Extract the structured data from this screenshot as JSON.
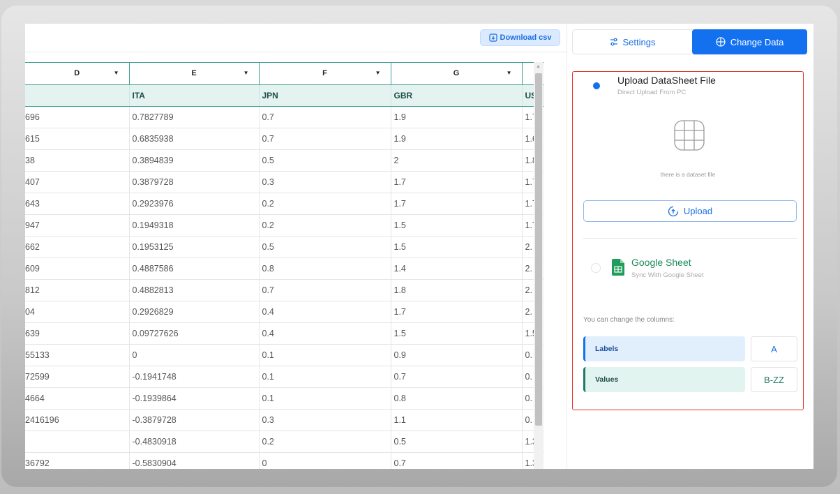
{
  "toolbar": {
    "download_label": "Download csv"
  },
  "table": {
    "column_letters": [
      "D",
      "E",
      "F",
      "G",
      ""
    ],
    "column_names": [
      "",
      "ITA",
      "JPN",
      "GBR",
      "US"
    ],
    "rows": [
      [
        "696",
        "0.7827789",
        "0.7",
        "1.9",
        "1.7"
      ],
      [
        "615",
        "0.6835938",
        "0.7",
        "1.9",
        "1.6"
      ],
      [
        "38",
        "0.3894839",
        "0.5",
        "2",
        "1.8"
      ],
      [
        "407",
        "0.3879728",
        "0.3",
        "1.7",
        "1.7"
      ],
      [
        "643",
        "0.2923976",
        "0.2",
        "1.7",
        "1.7"
      ],
      [
        "947",
        "0.1949318",
        "0.2",
        "1.5",
        "1.7"
      ],
      [
        "662",
        "0.1953125",
        "0.5",
        "1.5",
        "2."
      ],
      [
        "609",
        "0.4887586",
        "0.8",
        "1.4",
        "2."
      ],
      [
        "812",
        "0.4882813",
        "0.7",
        "1.8",
        "2."
      ],
      [
        "04",
        "0.2926829",
        "0.4",
        "1.7",
        "2."
      ],
      [
        "639",
        "0.09727626",
        "0.4",
        "1.5",
        "1.5"
      ],
      [
        "55133",
        "0",
        "0.1",
        "0.9",
        "0."
      ],
      [
        "72599",
        "-0.1941748",
        "0.1",
        "0.7",
        "0."
      ],
      [
        "4664",
        "-0.1939864",
        "0.1",
        "0.8",
        "0."
      ],
      [
        "2416196",
        "-0.3879728",
        "0.3",
        "1.1",
        "0."
      ],
      [
        "",
        "-0.4830918",
        "0.2",
        "0.5",
        "1.3"
      ],
      [
        "36792",
        "-0.5830904",
        "0",
        "0.7",
        "1.3"
      ]
    ]
  },
  "tabs": {
    "settings": "Settings",
    "change_data": "Change Data"
  },
  "upload": {
    "title": "Upload DataSheet File",
    "subtitle": "Direct Upload From PC",
    "dataset_note": "there is a dataset file",
    "button": "Upload"
  },
  "google": {
    "title": "Google Sheet",
    "subtitle": "Sync With Google Sheet"
  },
  "columns": {
    "label": "You can change the columns:",
    "labels_field": "Labels",
    "labels_value": "A",
    "values_field": "Values",
    "values_value": "B-ZZ"
  },
  "colors": {
    "accent": "#1371f0",
    "teal": "#3f9e8c",
    "panel_border": "#e3342f",
    "sheets_green": "#1a8a5a"
  }
}
